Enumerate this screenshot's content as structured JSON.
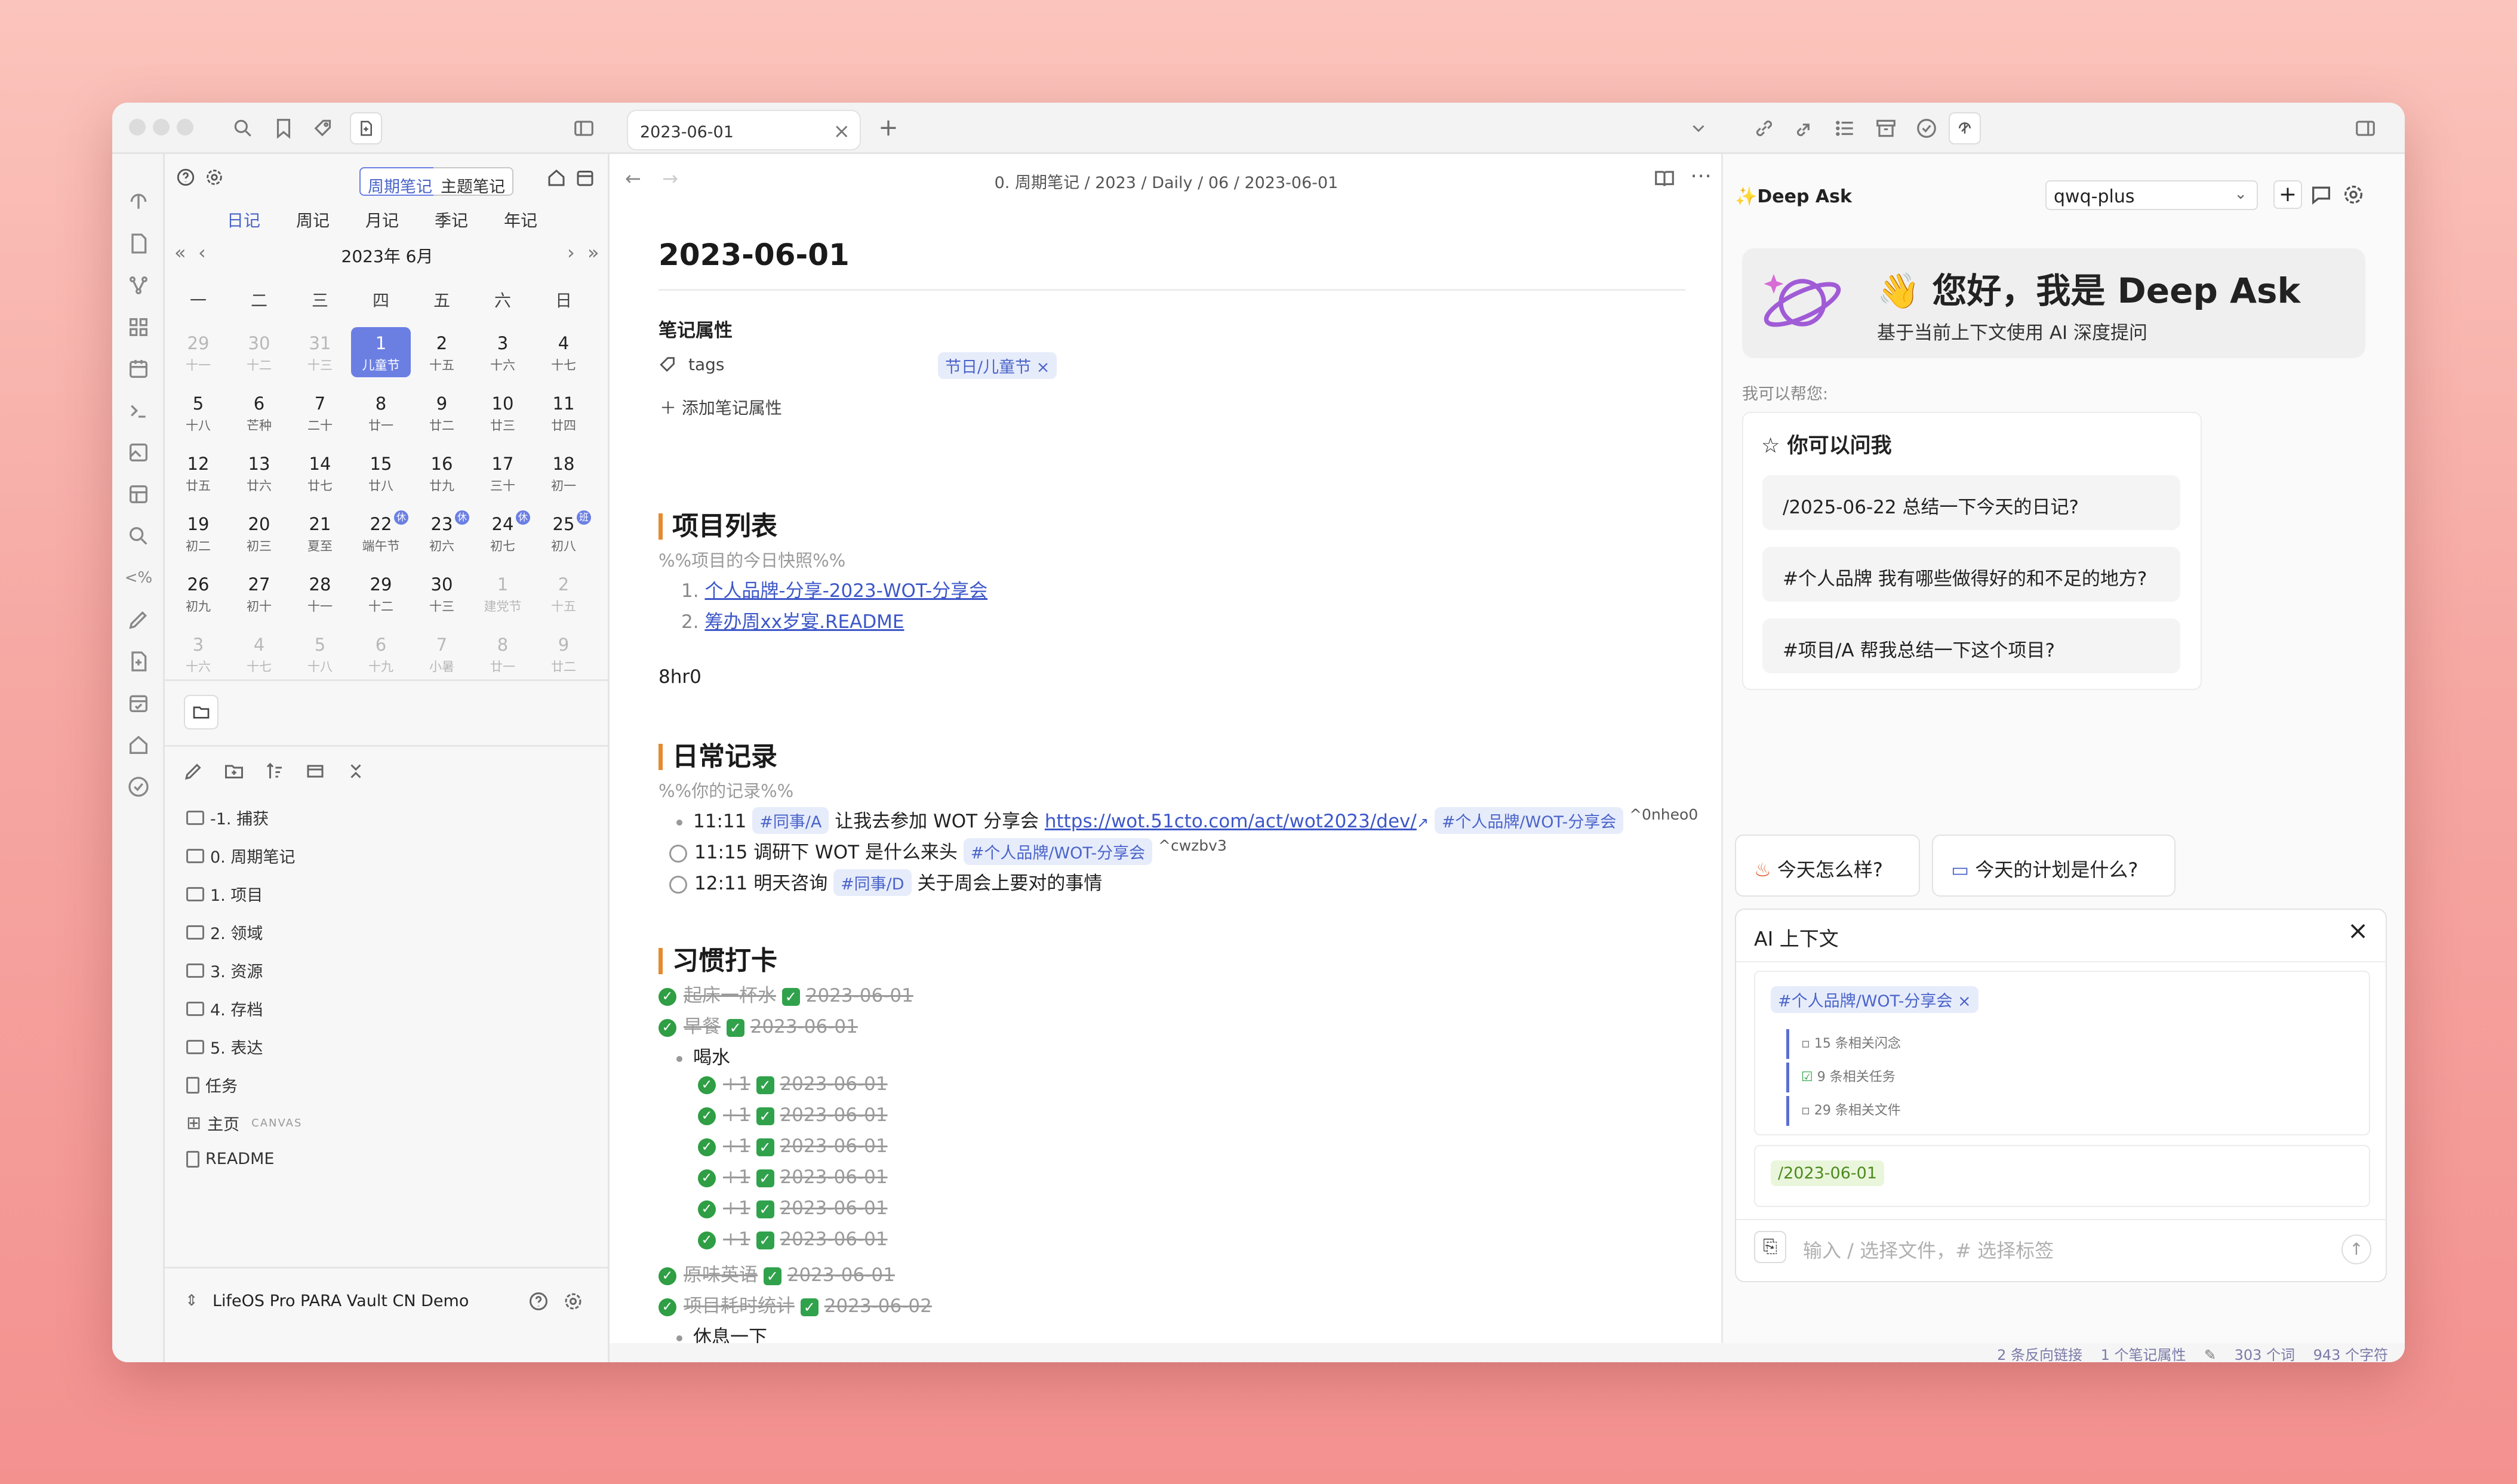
{
  "window": {
    "tab_title": "2023-06-01",
    "tab_close": "×",
    "new_tab": "+"
  },
  "calendar": {
    "seg_periodic": "周期笔记",
    "seg_topic": "主题笔记",
    "view_tabs": [
      "日记",
      "周记",
      "月记",
      "季记",
      "年记"
    ],
    "active_view": "日记",
    "month_title": "2023年 6月",
    "weekdays": [
      "一",
      "二",
      "三",
      "四",
      "五",
      "六",
      "日"
    ],
    "weeks": [
      [
        {
          "n": "29",
          "l": "十一",
          "dim": true
        },
        {
          "n": "30",
          "l": "十二",
          "dim": true
        },
        {
          "n": "31",
          "l": "十三",
          "dim": true
        },
        {
          "n": "1",
          "l": "儿童节",
          "sel": true
        },
        {
          "n": "2",
          "l": "十五"
        },
        {
          "n": "3",
          "l": "十六"
        },
        {
          "n": "4",
          "l": "十七"
        }
      ],
      [
        {
          "n": "5",
          "l": "十八"
        },
        {
          "n": "6",
          "l": "芒种"
        },
        {
          "n": "7",
          "l": "二十"
        },
        {
          "n": "8",
          "l": "廿一"
        },
        {
          "n": "9",
          "l": "廿二"
        },
        {
          "n": "10",
          "l": "廿三"
        },
        {
          "n": "11",
          "l": "廿四"
        }
      ],
      [
        {
          "n": "12",
          "l": "廿五"
        },
        {
          "n": "13",
          "l": "廿六"
        },
        {
          "n": "14",
          "l": "廿七"
        },
        {
          "n": "15",
          "l": "廿八"
        },
        {
          "n": "16",
          "l": "廿九"
        },
        {
          "n": "17",
          "l": "三十"
        },
        {
          "n": "18",
          "l": "初一"
        }
      ],
      [
        {
          "n": "19",
          "l": "初二"
        },
        {
          "n": "20",
          "l": "初三"
        },
        {
          "n": "21",
          "l": "夏至"
        },
        {
          "n": "22",
          "l": "端午节",
          "b": "休"
        },
        {
          "n": "23",
          "l": "初六",
          "b": "休"
        },
        {
          "n": "24",
          "l": "初七",
          "b": "休"
        },
        {
          "n": "25",
          "l": "初八",
          "b": "班"
        }
      ],
      [
        {
          "n": "26",
          "l": "初九"
        },
        {
          "n": "27",
          "l": "初十"
        },
        {
          "n": "28",
          "l": "十一"
        },
        {
          "n": "29",
          "l": "十二"
        },
        {
          "n": "30",
          "l": "十三"
        },
        {
          "n": "1",
          "l": "建党节",
          "dim": true
        },
        {
          "n": "2",
          "l": "十五",
          "dim": true
        }
      ],
      [
        {
          "n": "3",
          "l": "十六",
          "dim": true
        },
        {
          "n": "4",
          "l": "十七",
          "dim": true
        },
        {
          "n": "5",
          "l": "十八",
          "dim": true
        },
        {
          "n": "6",
          "l": "十九",
          "dim": true
        },
        {
          "n": "7",
          "l": "小暑",
          "dim": true
        },
        {
          "n": "8",
          "l": "廿一",
          "dim": true
        },
        {
          "n": "9",
          "l": "廿二",
          "dim": true
        }
      ]
    ]
  },
  "file_tree": {
    "items": [
      {
        "label": "-1. 捕获",
        "type": "folder"
      },
      {
        "label": "0. 周期笔记",
        "type": "folder"
      },
      {
        "label": "1. 项目",
        "type": "folder"
      },
      {
        "label": "2. 领域",
        "type": "folder"
      },
      {
        "label": "3. 资源",
        "type": "folder"
      },
      {
        "label": "4. 存档",
        "type": "folder"
      },
      {
        "label": "5. 表达",
        "type": "folder"
      },
      {
        "label": "任务",
        "type": "file"
      },
      {
        "label": "主页",
        "type": "canvas",
        "suffix": "CANVAS"
      },
      {
        "label": "README",
        "type": "file"
      }
    ],
    "vault_name": "LifeOS Pro PARA Vault CN Demo"
  },
  "editor": {
    "breadcrumb": [
      "0. 周期笔记",
      "2023",
      "Daily",
      "06",
      "2023-06-01"
    ],
    "title": "2023-06-01",
    "props_title": "笔记属性",
    "prop_key": "tags",
    "prop_tag": "节日/儿童节",
    "add_prop": "添加笔记属性",
    "sec1": {
      "title": "项目列表",
      "comment": "%%项目的今日快照%%",
      "items": [
        "个人品牌-分享-2023-WOT-分享会",
        "筹办周xx岁宴.README"
      ]
    },
    "time_line": "8hr0",
    "sec2": {
      "title": "日常记录",
      "comment": "%%你的记录%%",
      "l1_time": "11:11",
      "l1_tag": "#同事/A",
      "l1_text": "让我去参加 WOT 分享会",
      "l1_url": "https://wot.51cto.com/act/wot2023/dev/",
      "l1_tag2": "#个人品牌/WOT-分享会",
      "l1_id": "^0nheo0",
      "l2_text": "11:15 调研下 WOT 是什么来头",
      "l2_tag": "#个人品牌/WOT-分享会",
      "l2_id": "^cwzbv3",
      "l3_text": "12:11 明天咨询",
      "l3_tag": "#同事/D",
      "l3_text2": "关于周会上要对的事情"
    },
    "sec3": {
      "title": "习惯打卡",
      "h1": "起床一杯水",
      "h2": "早餐",
      "water": "喝水",
      "plus": "+1",
      "date": "2023-06-01",
      "h3": "原味英语",
      "h4": "项目耗时统计",
      "date2": "2023-06-02",
      "h5": "休息一下"
    }
  },
  "deepask": {
    "title": "Deep Ask",
    "model": "qwq-plus",
    "hero_title": "👋 您好，我是 Deep Ask",
    "hero_sub": "基于当前上下文使用 AI 深度提问",
    "help_label": "我可以帮您:",
    "ask_title": "你可以问我",
    "suggestions": [
      "/2025-06-22 总结一下今天的日记?",
      "#个人品牌 我有哪些做得好的和不足的地方?",
      "#项目/A 帮我总结一下这个项目?"
    ],
    "quick1": "今天怎么样?",
    "quick2": "今天的计划是什么?",
    "ctx_title": "AI 上下文",
    "ctx_tag": "#个人品牌/WOT-分享会",
    "ctx_rows": [
      "15 条相关闪念",
      "9 条相关任务",
      "29 条相关文件"
    ],
    "ctx_date": "/2023-06-01",
    "input_placeholder": "输入 / 选择文件，# 选择标签"
  },
  "status": {
    "backlinks": "2 条反向链接",
    "props": "1 个笔记属性",
    "words": "303 个词",
    "chars": "943 个字符"
  },
  "colors": {
    "accent": "#6b7fe3",
    "heading_bar": "#e58a2e",
    "check": "#2f9e44"
  }
}
